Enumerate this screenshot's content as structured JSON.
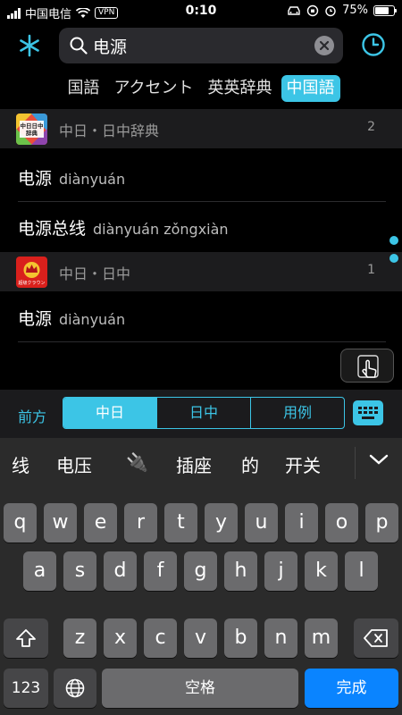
{
  "status": {
    "carrier": "中国电信",
    "vpn": "VPN",
    "time": "0:10",
    "battery": "75%",
    "battery_level": 0.75
  },
  "search": {
    "query": "电源"
  },
  "dict_tabs": [
    "国語",
    "アクセント",
    "英英辞典",
    "中国語"
  ],
  "sections": [
    {
      "title": "中日・日中辞典",
      "count": "2",
      "rows": [
        {
          "word": "电源",
          "pinyin": "diànyuán"
        },
        {
          "word": "电源总线",
          "pinyin": "diànyuán zǒngxiàn"
        }
      ]
    },
    {
      "title": "中日・日中",
      "count": "1",
      "rows": [
        {
          "word": "电源",
          "pinyin": "diànyuán"
        }
      ]
    }
  ],
  "logo_text": {
    "first": "中日日中辞典",
    "second": "超级クラウン"
  },
  "mode_bar": {
    "front_label": "前方",
    "segments": [
      "中日",
      "日中",
      "用例"
    ],
    "active_segment": 0
  },
  "candidates": [
    "线",
    "电压",
    "🔌",
    "插座",
    "的",
    "开关"
  ],
  "keyboard": {
    "row1": [
      "q",
      "w",
      "e",
      "r",
      "t",
      "y",
      "u",
      "i",
      "o",
      "p"
    ],
    "row2": [
      "a",
      "s",
      "d",
      "f",
      "g",
      "h",
      "j",
      "k",
      "l"
    ],
    "row3": [
      "z",
      "x",
      "c",
      "v",
      "b",
      "n",
      "m"
    ],
    "numbers_key": "123",
    "space_key": "空格",
    "done_key": "完成"
  },
  "colors": {
    "accent": "#3cc5e6",
    "done_blue": "#0a84ff"
  }
}
